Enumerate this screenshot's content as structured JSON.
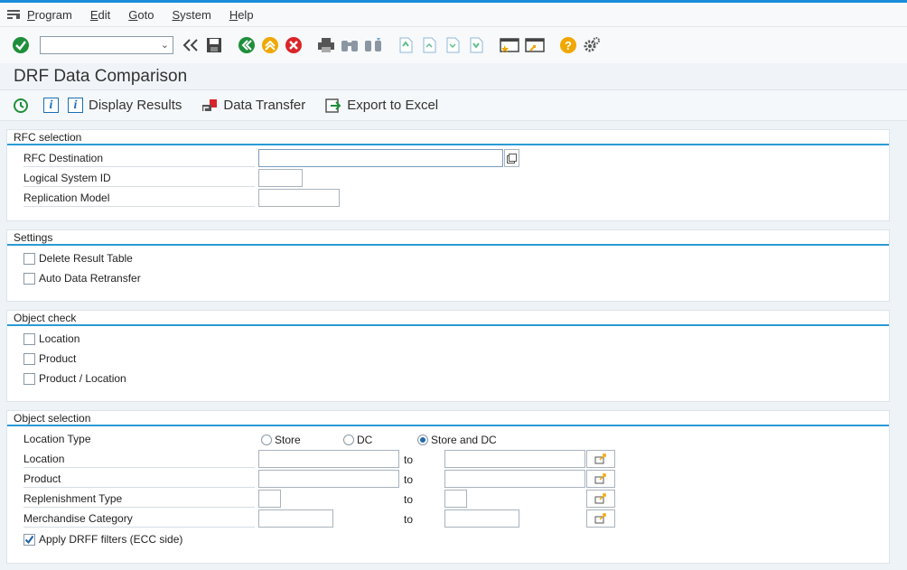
{
  "menu": [
    "Program",
    "Edit",
    "Goto",
    "System",
    "Help"
  ],
  "menu_underline": [
    "P",
    "E",
    "G",
    "S",
    "H"
  ],
  "title": "DRF Data Comparison",
  "app_toolbar": {
    "display_results": "Display Results",
    "data_transfer": "Data Transfer",
    "export_excel": "Export to Excel"
  },
  "rfc": {
    "header": "RFC selection",
    "rfc_destination": "RFC Destination",
    "logical_system": "Logical System ID",
    "replication_model": "Replication Model"
  },
  "settings": {
    "header": "Settings",
    "delete_result": "Delete Result Table",
    "auto_retransfer": "Auto Data Retransfer"
  },
  "object_check": {
    "header": "Object check",
    "location": "Location",
    "product": "Product",
    "product_location": "Product / Location"
  },
  "object_selection": {
    "header": "Object selection",
    "location_type": "Location Type",
    "radio_store": "Store",
    "radio_dc": "DC",
    "radio_store_dc": "Store and DC",
    "selected_radio": "Store and DC",
    "location": "Location",
    "product": "Product",
    "replenishment_type": "Replenishment Type",
    "merch_category": "Merchandise Category",
    "to": "to",
    "apply_drff": "Apply DRFF filters (ECC side)",
    "apply_drff_checked": true
  },
  "colors": {
    "accent": "#2b9ad6",
    "ok_green": "#1e8f3a",
    "cancel_red": "#d9252a",
    "help_yellow": "#f0a800"
  }
}
